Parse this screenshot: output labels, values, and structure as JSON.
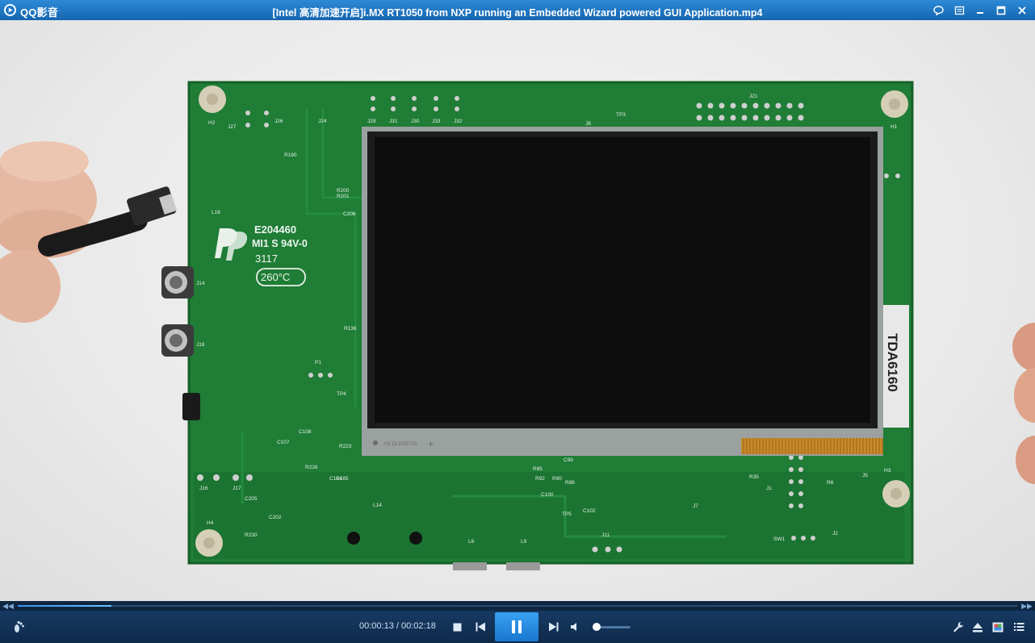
{
  "app": {
    "name": "QQ影音",
    "window_title": "[Intel 高清加速开启]i.MX RT1050 from NXP running an Embedded Wizard powered GUI Application.mp4"
  },
  "video": {
    "board_text": {
      "ul_code": "E204460",
      "rating": "MI1 S 94V-0",
      "date_code": "3117",
      "temp": "260°C",
      "chip_label": "TDA6160",
      "lcd_print": "AS DLD0573A",
      "silk": [
        "H1",
        "H2",
        "H3",
        "H4",
        "J1",
        "J11",
        "J14",
        "J16",
        "J17",
        "J18",
        "J21",
        "J24",
        "J26",
        "J27",
        "J29",
        "J30",
        "J31",
        "J32",
        "J33",
        "L14",
        "L16",
        "TP3",
        "TP4",
        "TP5",
        "SW1",
        "R190",
        "R200",
        "R201",
        "C206",
        "R136",
        "C107",
        "C108",
        "R226",
        "C184",
        "C185",
        "R223",
        "R85",
        "C99",
        "C100",
        "C102",
        "R92",
        "R90",
        "R86",
        "R230",
        "C202",
        "C205",
        "R35",
        "J2",
        "J5",
        "J7",
        "P1",
        "R6",
        "J8",
        "L6",
        "L9"
      ]
    }
  },
  "playback": {
    "current_time": "00:00:13",
    "separator": " / ",
    "total_time": "00:02:18",
    "progress": 0.094,
    "volume": 0.05
  },
  "colors": {
    "titlebar": "#1f77c8",
    "accent": "#2f95ea",
    "controls_bg": "#0f2a4a",
    "pcb": "#1c7a34"
  },
  "icons": {
    "logo": "qq-player-logo-icon",
    "window": [
      "chat-bubble-icon",
      "list-window-icon",
      "minimize-icon",
      "maximize-icon",
      "close-icon"
    ],
    "left": [
      "footprint-icon"
    ],
    "playback": [
      "stop-icon",
      "previous-icon",
      "pause-icon",
      "next-icon",
      "volume-icon"
    ],
    "right": [
      "wrench-icon",
      "eject-icon",
      "screen-color-icon",
      "playlist-icon"
    ]
  }
}
